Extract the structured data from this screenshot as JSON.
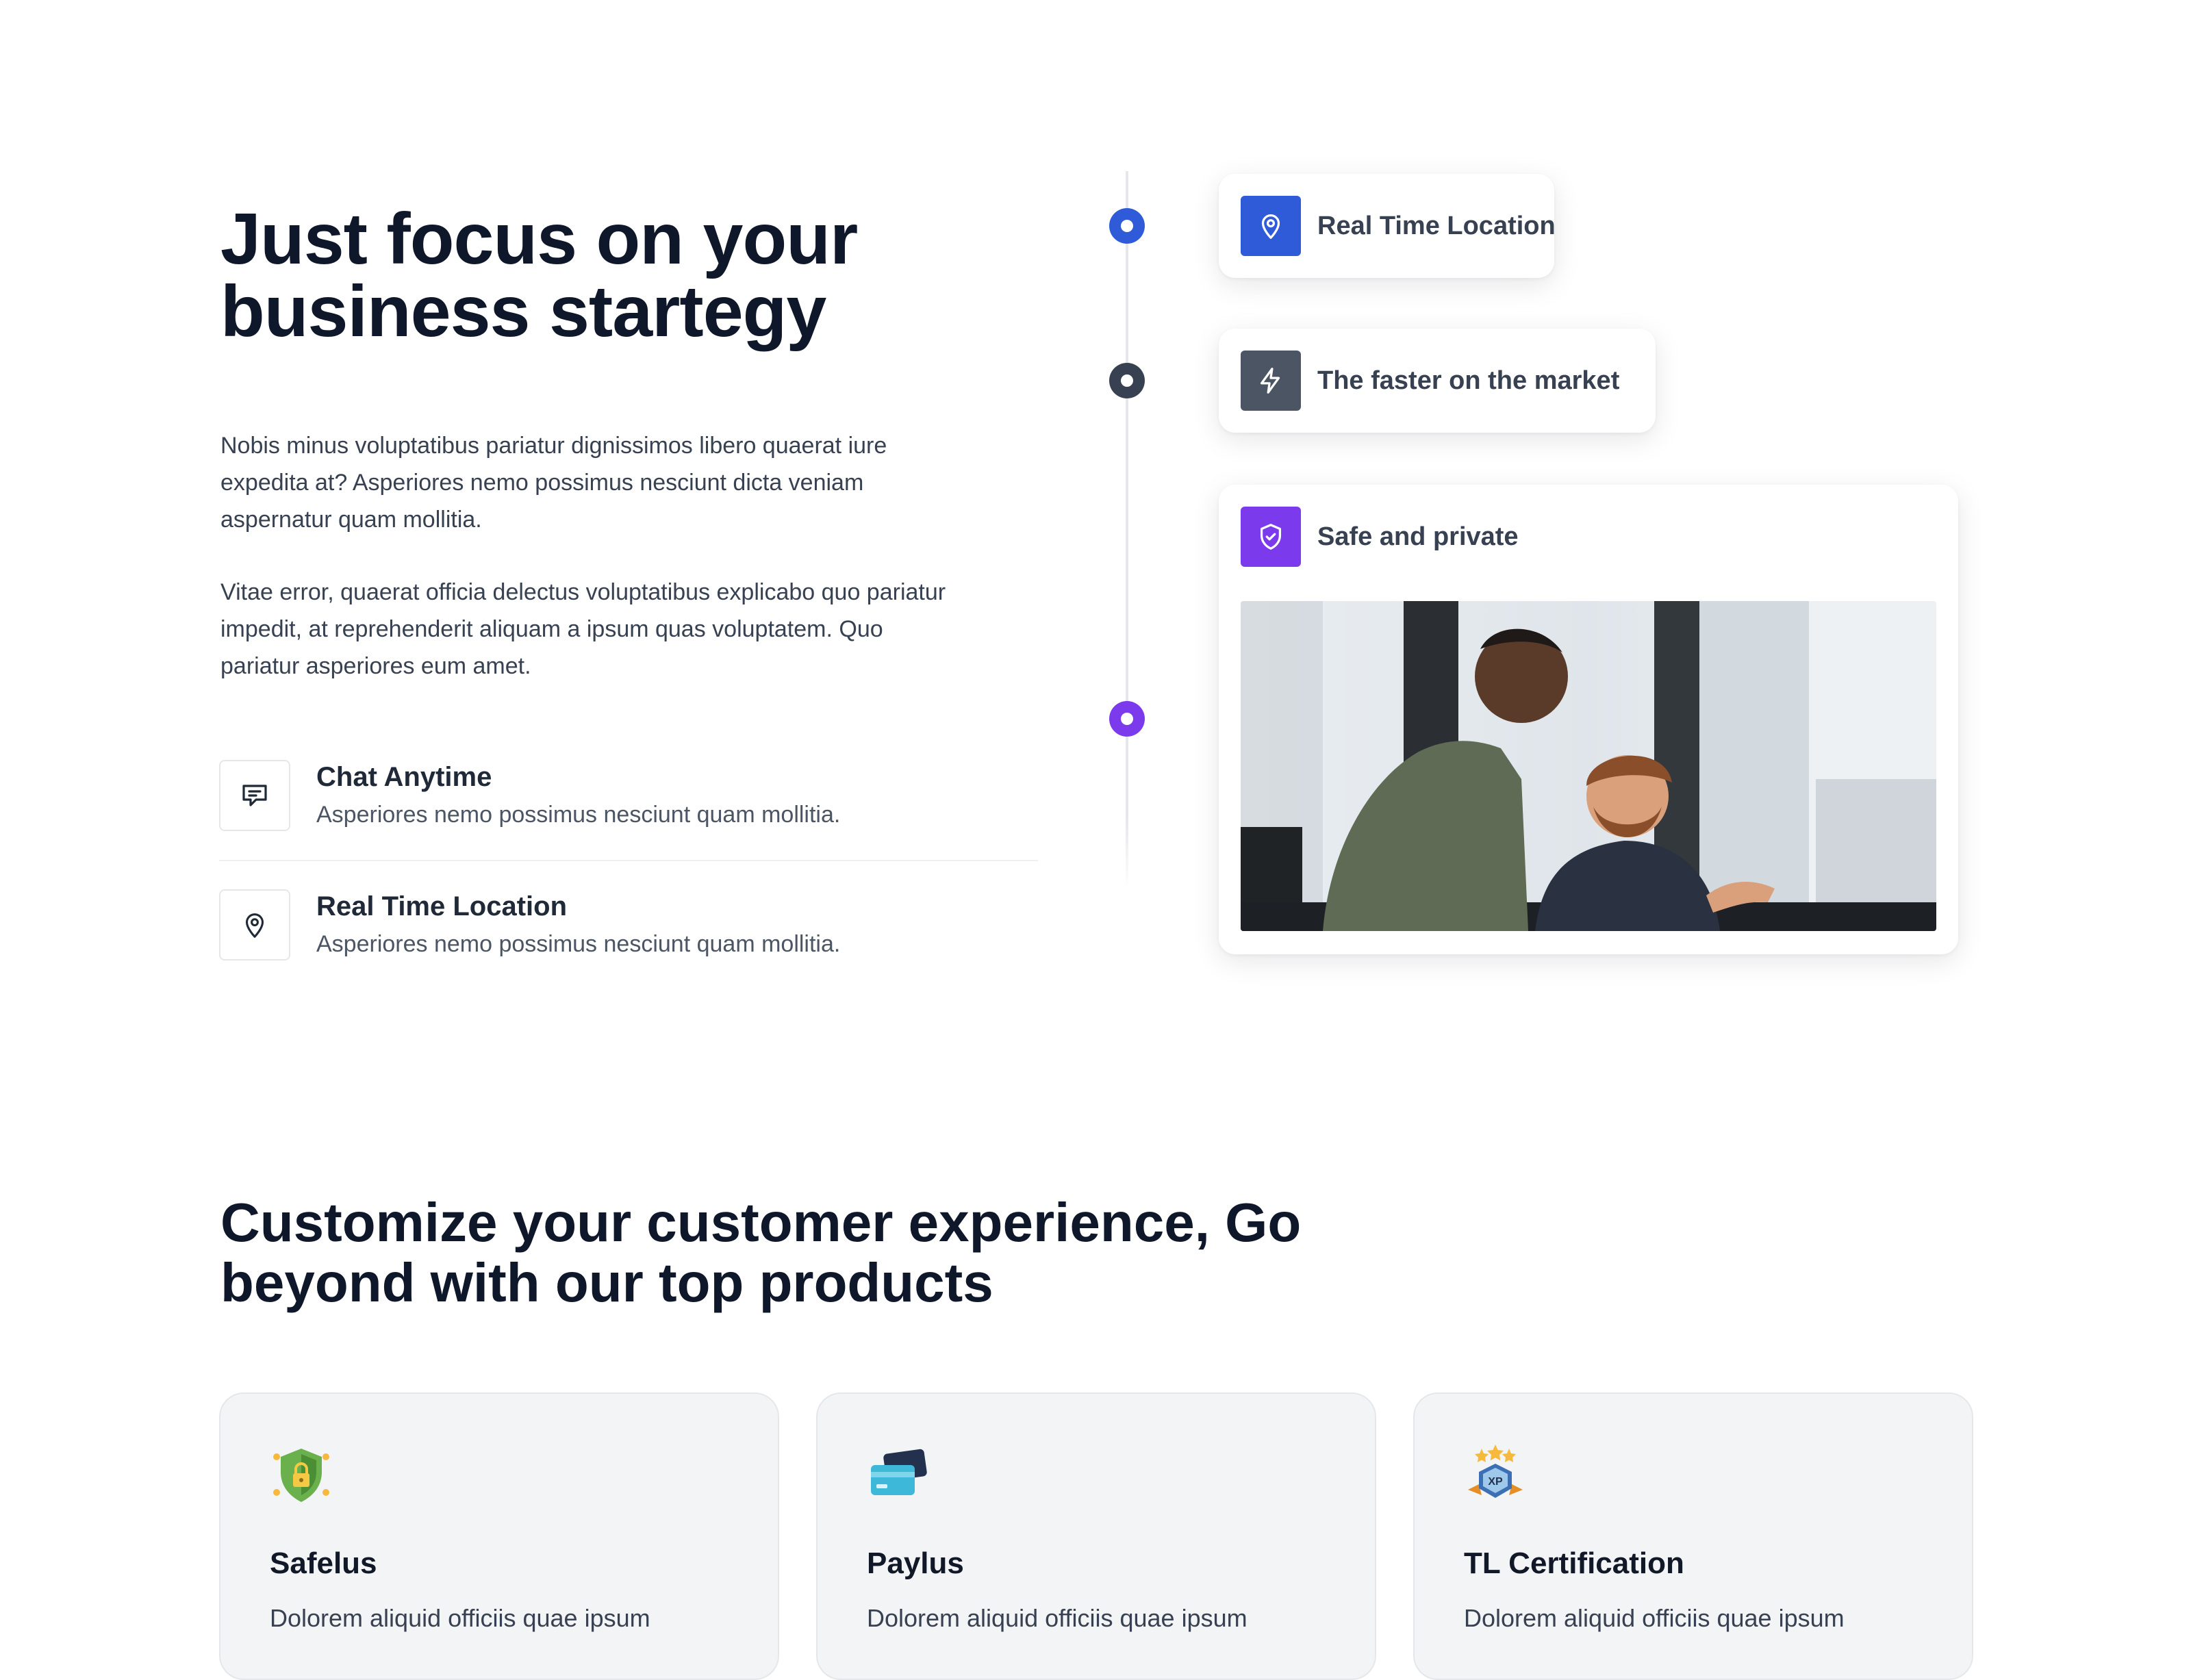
{
  "hero": {
    "title_lines": [
      "Just focus on your",
      "business startegy"
    ],
    "paragraph_1_lines": [
      "Nobis minus voluptatibus pariatur dignissimos libero quaerat iure",
      "expedita at? Asperiores nemo possimus nesciunt dicta veniam",
      "aspernatur quam mollitia."
    ],
    "paragraph_2_lines": [
      "Vitae error, quaerat officia delectus voluptatibus explicabo quo pariatur",
      "impedit, at reprehenderit aliquam a ipsum quas voluptatem. Quo",
      "pariatur asperiores eum amet."
    ],
    "features": [
      {
        "icon": "chat-icon",
        "title": "Chat Anytime",
        "desc": "Asperiores nemo possimus nesciunt quam mollitia."
      },
      {
        "icon": "location-pin-icon",
        "title": "Real Time Location",
        "desc": "Asperiores nemo possimus nesciunt quam mollitia."
      }
    ]
  },
  "timeline": {
    "items": [
      {
        "icon": "location-pin-icon",
        "label": "Real Time Location",
        "color": "#2f5bd8"
      },
      {
        "icon": "lightning-icon",
        "label": "The faster on the market",
        "color": "#4b5563"
      },
      {
        "icon": "shield-check-icon",
        "label": "Safe and private",
        "color": "#7c3aed"
      }
    ],
    "photo": "two-men-office-photo"
  },
  "products": {
    "title_lines": [
      "Customize your customer experience, Go",
      "beyond with our top products"
    ],
    "cards": [
      {
        "icon": "shield-lock-icon",
        "title": "Safelus",
        "desc": "Dolorem aliquid officiis quae ipsum"
      },
      {
        "icon": "credit-cards-icon",
        "title": "Paylus",
        "desc": "Dolorem aliquid officiis quae ipsum"
      },
      {
        "icon": "xp-badge-icon",
        "title": "TL Certification",
        "desc": "Dolorem aliquid officiis quae ipsum"
      }
    ]
  }
}
